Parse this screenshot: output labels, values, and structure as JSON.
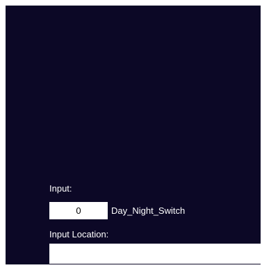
{
  "form": {
    "input_label": "Input:",
    "input_value": "0",
    "switch_name": "Day_Night_Switch",
    "location_label": "Input Location:",
    "location_value": ""
  },
  "colors": {
    "background": "#0c0826",
    "field_background": "#ffffff",
    "text": "#ffffff"
  }
}
